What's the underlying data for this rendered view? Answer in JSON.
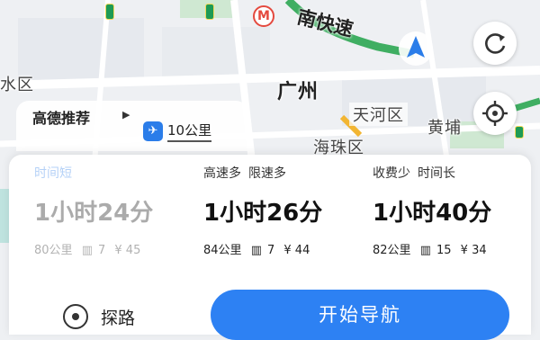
{
  "map": {
    "road_badges": [
      "",
      "",
      ""
    ],
    "express_label": "南快速",
    "city_label": "广州",
    "district_left": "水区",
    "district_tianhe": "天河区",
    "district_haizhu": "海珠区",
    "district_huangpu": "黄埔"
  },
  "route_header": {
    "recommend": "高德推荐",
    "distance": "10公里"
  },
  "options": [
    {
      "tags": [
        "时间短"
      ],
      "time": "1小时24分",
      "distance": "80公里",
      "lights": "7",
      "cost": "¥ 45",
      "faded": true
    },
    {
      "tags": [
        "高速多",
        "限速多"
      ],
      "time": "1小时26分",
      "distance": "84公里",
      "lights": "7",
      "cost": "¥ 44",
      "faded": false
    },
    {
      "tags": [
        "收费少",
        "时间长"
      ],
      "time": "1小时40分",
      "distance": "82公里",
      "lights": "15",
      "cost": "¥ 34",
      "faded": false
    }
  ],
  "actions": {
    "explore": "探路",
    "start_navigation": "开始导航"
  },
  "colors": {
    "accent": "#2d81f3",
    "road_green": "#1d9a55",
    "metro_red": "#e4493e"
  },
  "icons": [
    "plane-icon",
    "metro-icon",
    "compass-arrow-icon",
    "refresh-icon",
    "locate-icon",
    "explore-icon",
    "traffic-light-icon"
  ]
}
